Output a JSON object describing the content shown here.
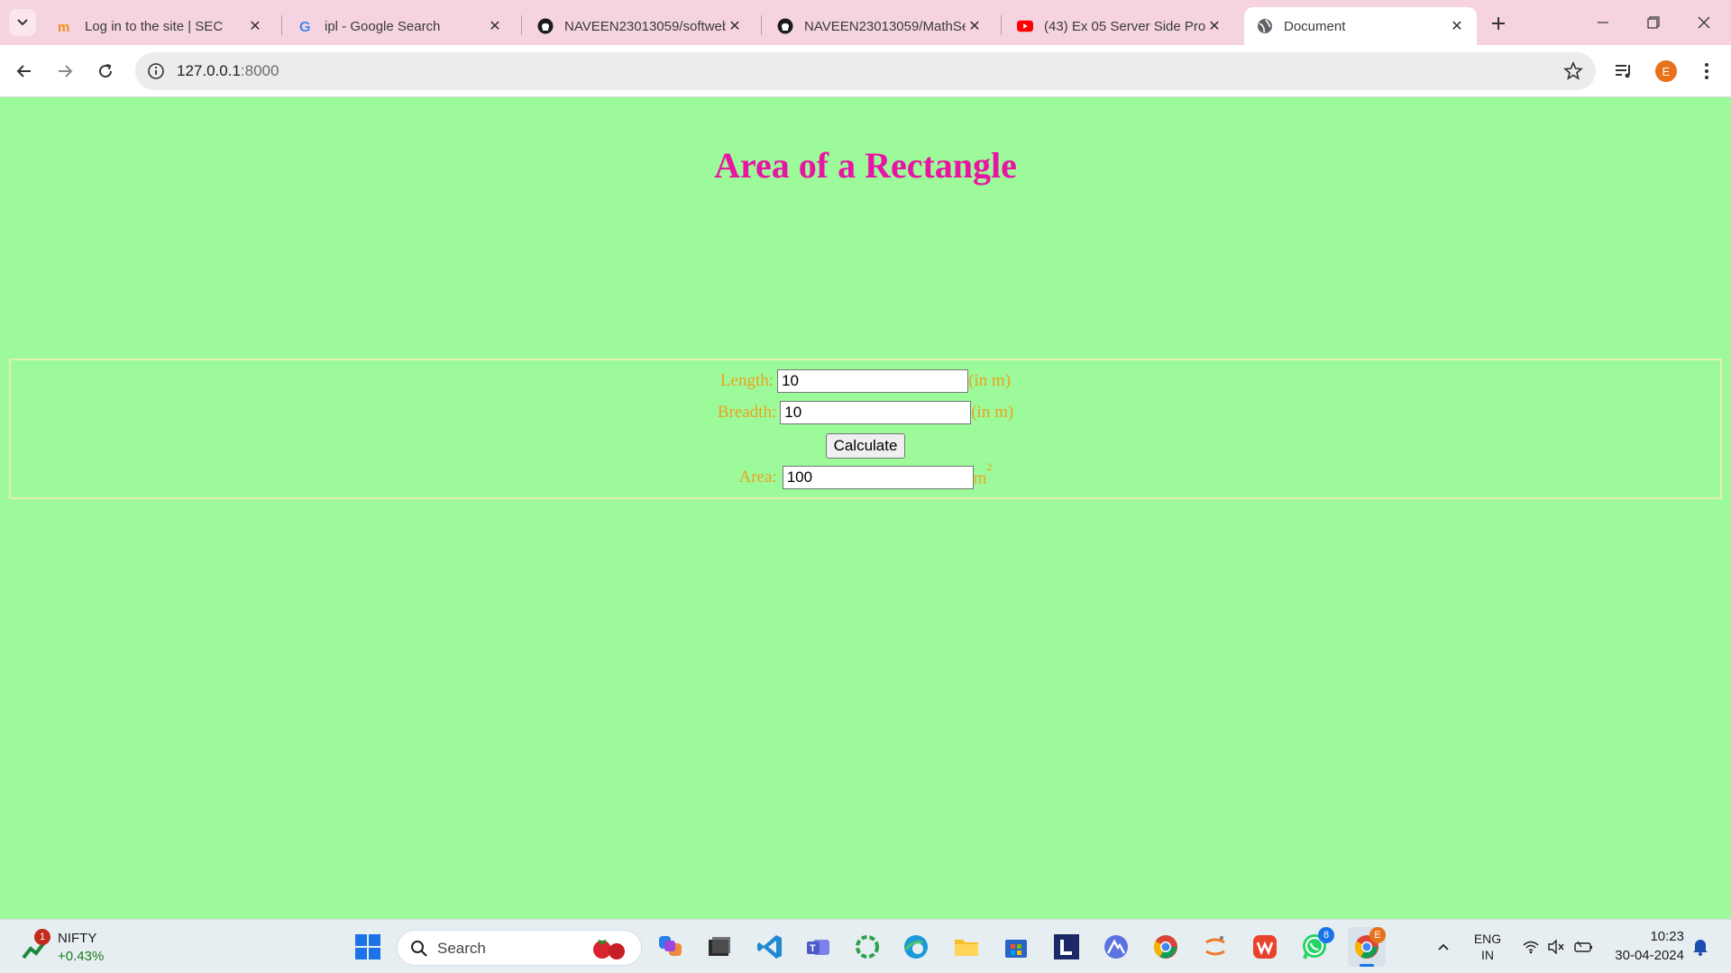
{
  "browser": {
    "tabs": [
      {
        "title": "Log in to the site | SEC",
        "icon": "moodle-icon"
      },
      {
        "title": "ipl - Google Search",
        "icon": "google-icon"
      },
      {
        "title": "NAVEEN23013059/softweb",
        "icon": "github-icon"
      },
      {
        "title": "NAVEEN23013059/MathSe",
        "icon": "github-icon"
      },
      {
        "title": "(43) Ex 05 Server Side Proc",
        "icon": "youtube-icon"
      },
      {
        "title": "Document",
        "icon": "globe-icon",
        "active": true
      }
    ],
    "url_host": "127.0.0.1",
    "url_port": ":8000",
    "profile_initial": "E"
  },
  "page": {
    "title": "Area of a Rectangle",
    "length_label": "Length:",
    "length_value": "10",
    "breadth_label": "Breadth:",
    "breadth_value": "10",
    "unit_label": "(in m)",
    "calculate_label": "Calculate",
    "area_label": "Area:",
    "area_value": "100",
    "area_unit": "m",
    "area_unit_exponent": "2"
  },
  "taskbar": {
    "widget_name": "NIFTY",
    "widget_change": "+0.43%",
    "widget_badge": "1",
    "search_label": "Search",
    "whatsapp_badge": "8",
    "chrome_badge": "E",
    "lang_line1": "ENG",
    "lang_line2": "IN",
    "time": "10:23",
    "date": "30-04-2024"
  },
  "colors": {
    "page_bg": "#9cfa9a",
    "title": "#e814a4",
    "labels": "#f0a020",
    "tabstrip": "#f5d3e0"
  }
}
